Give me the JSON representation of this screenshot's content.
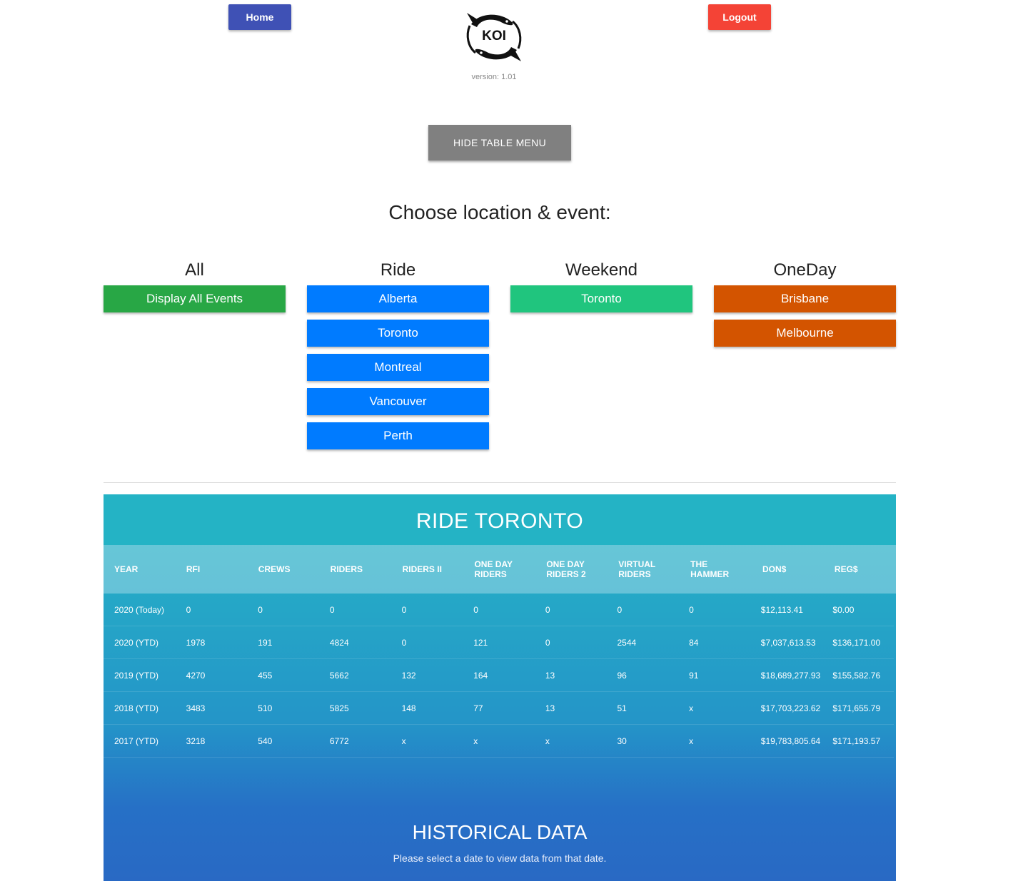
{
  "header": {
    "home_label": "Home",
    "logout_label": "Logout",
    "logo_text": "KOI",
    "version": "version: 1.01"
  },
  "menu": {
    "toggle_label": "HIDE TABLE MENU",
    "title": "Choose location & event:",
    "columns": [
      {
        "title": "All",
        "buttons": [
          "Display All Events"
        ]
      },
      {
        "title": "Ride",
        "buttons": [
          "Alberta",
          "Toronto",
          "Montreal",
          "Vancouver",
          "Perth"
        ]
      },
      {
        "title": "Weekend",
        "buttons": [
          "Toronto"
        ]
      },
      {
        "title": "OneDay",
        "buttons": [
          "Brisbane",
          "Melbourne"
        ]
      }
    ]
  },
  "colors": {
    "home": "#3f51b5",
    "logout": "#f44336",
    "all": "#28a745",
    "ride": "#007bff",
    "weekend": "#20c57e",
    "oneday": "#d35400"
  },
  "table": {
    "title": "RIDE TORONTO",
    "headers": [
      "YEAR",
      "RFI",
      "CREWS",
      "RIDERS",
      "RIDERS II",
      "ONE DAY RIDERS",
      "ONE DAY RIDERS 2",
      "VIRTUAL RIDERS",
      "THE HAMMER",
      "DON$",
      "REG$"
    ],
    "rows": [
      [
        "2020 (Today)",
        "0",
        "0",
        "0",
        "0",
        "0",
        "0",
        "0",
        "0",
        "$12,113.41",
        "$0.00"
      ],
      [
        "2020 (YTD)",
        "1978",
        "191",
        "4824",
        "0",
        "121",
        "0",
        "2544",
        "84",
        "$7,037,613.53",
        "$136,171.00"
      ],
      [
        "2019 (YTD)",
        "4270",
        "455",
        "5662",
        "132",
        "164",
        "13",
        "96",
        "91",
        "$18,689,277.93",
        "$155,582.76"
      ],
      [
        "2018 (YTD)",
        "3483",
        "510",
        "5825",
        "148",
        "77",
        "13",
        "51",
        "x",
        "$17,703,223.62",
        "$171,655.79"
      ],
      [
        "2017 (YTD)",
        "3218",
        "540",
        "6772",
        "x",
        "x",
        "x",
        "30",
        "x",
        "$19,783,805.64",
        "$171,193.57"
      ]
    ]
  },
  "historical": {
    "title": "HISTORICAL DATA",
    "subtitle": "Please select a date to view data from that date."
  }
}
